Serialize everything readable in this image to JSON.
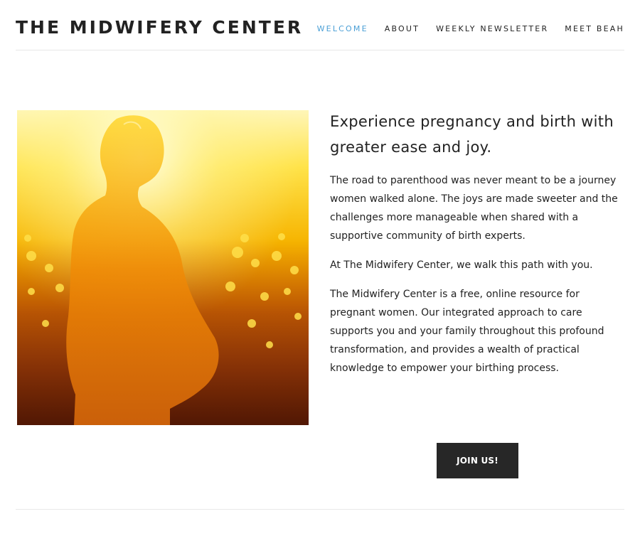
{
  "site": {
    "title": "THE MIDWIFERY CENTER"
  },
  "nav": {
    "items": [
      {
        "label": "WELCOME",
        "active": true
      },
      {
        "label": "ABOUT",
        "active": false
      },
      {
        "label": "WEEKLY NEWSLETTER",
        "active": false
      },
      {
        "label": "MEET BEAH",
        "active": false
      }
    ],
    "active_color": "#4a9fd6"
  },
  "hero": {
    "image": "silhouette of pregnant woman in sunlit dandelion field"
  },
  "main": {
    "headline": "Experience pregnancy and birth with greater ease and joy.",
    "paragraphs": [
      "The road to parenthood was never meant to be a journey women walked alone. The joys are made sweeter and the challenges more manageable when shared with a supportive community of birth experts.",
      "At The Midwifery Center, we walk this path with you.",
      "The Midwifery Center is a free, online resource for pregnant women. Our integrated approach to care supports you and your family throughout this profound transformation, and provides a wealth of practical knowledge to empower your birthing process."
    ],
    "cta_label": "JOIN US!"
  },
  "colors": {
    "text": "#222222",
    "button_bg": "#272727",
    "button_text": "#ffffff"
  }
}
